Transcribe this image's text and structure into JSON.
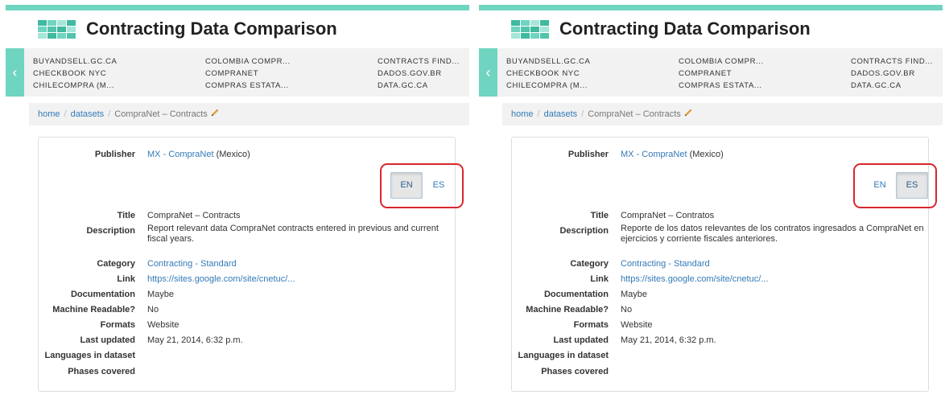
{
  "panels": [
    {
      "app_title": "Contracting Data Comparison",
      "datasets_nav": {
        "prev_label": "‹",
        "columns": [
          [
            "BUYANDSELL.GC.CA",
            "CHECKBOOK NYC",
            "CHILECOMPRA (M..."
          ],
          [
            "COLOMBIA COMPR...",
            "COMPRANET",
            "COMPRAS ESTATA..."
          ],
          [
            "CONTRACTS FIND...",
            "DADOS.GOV.BR",
            "DATA.GC.CA"
          ]
        ]
      },
      "breadcrumb": {
        "home": "home",
        "datasets": "datasets",
        "current": "CompraNet – Contracts",
        "edit_icon": "pencil-icon"
      },
      "language_toggle": {
        "options": [
          "EN",
          "ES"
        ],
        "selected": "EN"
      },
      "fields": {
        "publisher_label": "Publisher",
        "publisher_link": "MX - CompraNet",
        "publisher_country": " (Mexico)",
        "title_label": "Title",
        "title_value": "CompraNet – Contracts",
        "description_label": "Description",
        "description_value": "Report relevant data CompraNet contracts entered in previous and current fiscal years.",
        "category_label": "Category",
        "category_value": "Contracting - Standard",
        "link_label": "Link",
        "link_value": "https://sites.google.com/site/cnetuc/...",
        "documentation_label": "Documentation",
        "documentation_value": "Maybe",
        "machine_readable_label": "Machine Readable?",
        "machine_readable_value": "No",
        "formats_label": "Formats",
        "formats_value": "Website",
        "last_updated_label": "Last updated",
        "last_updated_value": "May 21, 2014, 6:32 p.m.",
        "languages_label": "Languages in dataset",
        "languages_value": "",
        "phases_label": "Phases covered",
        "phases_value": ""
      }
    },
    {
      "app_title": "Contracting Data Comparison",
      "datasets_nav": {
        "prev_label": "‹",
        "columns": [
          [
            "BUYANDSELL.GC.CA",
            "CHECKBOOK NYC",
            "CHILECOMPRA (M..."
          ],
          [
            "COLOMBIA COMPR...",
            "COMPRANET",
            "COMPRAS ESTATA..."
          ],
          [
            "CONTRACTS FIND...",
            "DADOS.GOV.BR",
            "DATA.GC.CA"
          ]
        ]
      },
      "breadcrumb": {
        "home": "home",
        "datasets": "datasets",
        "current": "CompraNet – Contracts",
        "edit_icon": "pencil-icon"
      },
      "language_toggle": {
        "options": [
          "EN",
          "ES"
        ],
        "selected": "ES"
      },
      "fields": {
        "publisher_label": "Publisher",
        "publisher_link": "MX - CompraNet",
        "publisher_country": " (Mexico)",
        "title_label": "Title",
        "title_value": "CompraNet – Contratos",
        "description_label": "Description",
        "description_value": "Reporte de los datos relevantes de los contratos ingresados a CompraNet en ejercicios y corriente fiscales anteriores.",
        "category_label": "Category",
        "category_value": "Contracting - Standard",
        "link_label": "Link",
        "link_value": "https://sites.google.com/site/cnetuc/...",
        "documentation_label": "Documentation",
        "documentation_value": "Maybe",
        "machine_readable_label": "Machine Readable?",
        "machine_readable_value": "No",
        "formats_label": "Formats",
        "formats_value": "Website",
        "last_updated_label": "Last updated",
        "last_updated_value": "May 21, 2014, 6:32 p.m.",
        "languages_label": "Languages in dataset",
        "languages_value": "",
        "phases_label": "Phases covered",
        "phases_value": ""
      }
    }
  ],
  "colors": {
    "accent": "#6fd4c0",
    "link": "#337ab7",
    "annotation_outline": "#d9262c",
    "logo_tiles": [
      "#3fb99f",
      "#6fd4c0",
      "#a6e6d9",
      "#52c4ab"
    ]
  }
}
